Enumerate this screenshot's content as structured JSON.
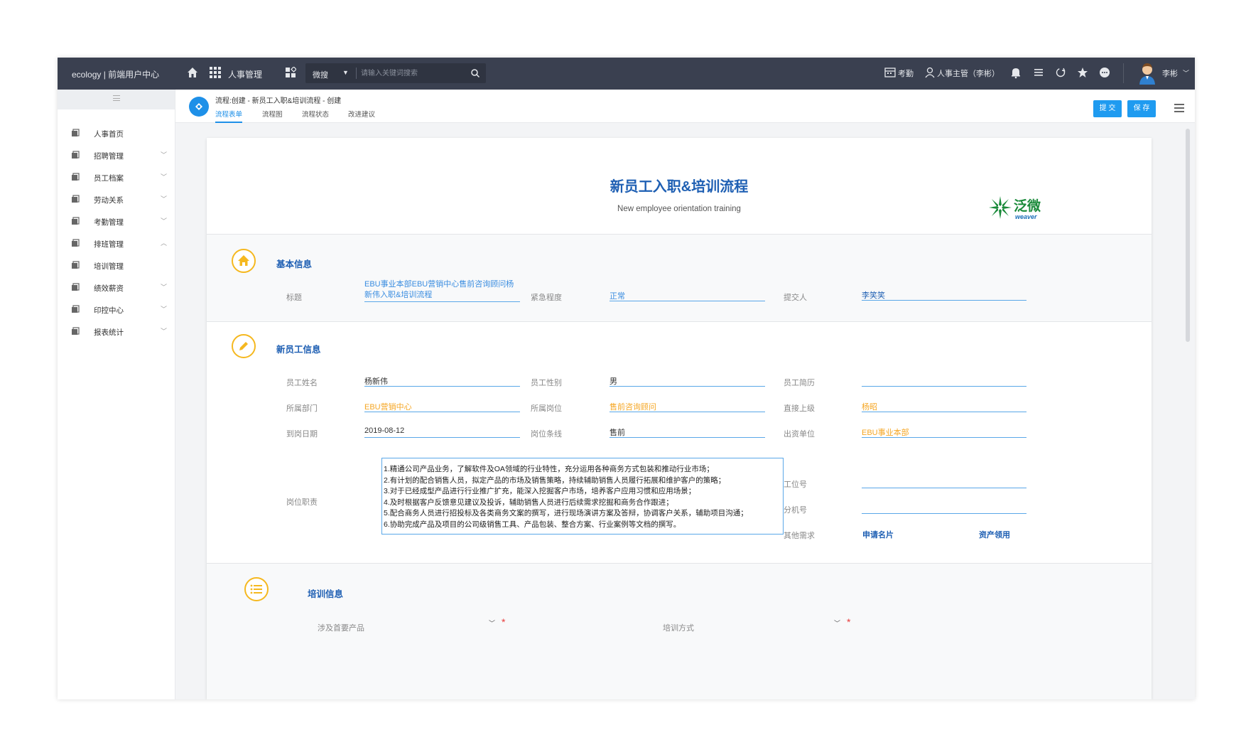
{
  "topbar": {
    "brand": "ecology | 前端用户中心",
    "module": "人事管理",
    "search_scope": "微搜",
    "search_placeholder": "请输入关键词搜索",
    "attendance": "考勤",
    "role": "人事主管（李彬）",
    "user": "李彬"
  },
  "sidebar": {
    "items": [
      {
        "label": "人事首页",
        "chevron": ""
      },
      {
        "label": "招聘管理",
        "chevron": "﹀"
      },
      {
        "label": "员工档案",
        "chevron": "﹀"
      },
      {
        "label": "劳动关系",
        "chevron": "﹀"
      },
      {
        "label": "考勤管理",
        "chevron": "﹀"
      },
      {
        "label": "排班管理",
        "chevron": "︿"
      },
      {
        "label": "培训管理",
        "chevron": ""
      },
      {
        "label": "绩效薪资",
        "chevron": "﹀"
      },
      {
        "label": "印控中心",
        "chevron": "﹀"
      },
      {
        "label": "报表统计",
        "chevron": "﹀"
      }
    ]
  },
  "workflow": {
    "breadcrumb": "流程:创建 - 新员工入职&培训流程 - 创建",
    "tabs": [
      {
        "label": "流程表单",
        "active": true
      },
      {
        "label": "流程图",
        "active": false
      },
      {
        "label": "流程状态",
        "active": false
      },
      {
        "label": "改进建议",
        "active": false
      }
    ],
    "submit_label": "提 交",
    "save_label": "保 存"
  },
  "form": {
    "title": "新员工入职&培训流程",
    "subtitle": "New employee orientation training",
    "logo_cn": "泛微",
    "logo_en": "weaver",
    "basic": {
      "section_title": "基本信息",
      "title_label": "标题",
      "title_value": "EBU事业本部EBU营销中心售前咨询顾问杨新伟入职&培训流程",
      "urgency_label": "紧急程度",
      "urgency_value": "正常",
      "submitter_label": "提交人",
      "submitter_value": "李笑笑"
    },
    "employee": {
      "section_title": "新员工信息",
      "name_label": "员工姓名",
      "name_value": "杨新伟",
      "gender_label": "员工性别",
      "gender_value": "男",
      "resume_label": "员工简历",
      "resume_value": "",
      "dept_label": "所属部门",
      "dept_value": "EBU营销中心",
      "position_label": "所属岗位",
      "position_value": "售前咨询顾问",
      "manager_label": "直接上级",
      "manager_value": "杨昭",
      "date_label": "到岗日期",
      "date_value": "2019-08-12",
      "line_label": "岗位条线",
      "line_value": "售前",
      "unit_label": "出资单位",
      "unit_value": "EBU事业本部",
      "duty_label": "岗位职责",
      "duties": [
        "1.精通公司产品业务，了解软件及OA领域的行业特性，充分运用各种商务方式包装和推动行业市场；",
        "2.有计划的配合销售人员，拟定产品的市场及销售策略，持续辅助销售人员履行拓展和维护客户的策略；",
        "3.对于已经成型产品进行行业推广扩充，能深入挖掘客户市场，培养客户应用习惯和应用场景；",
        "4.及时根据客户反馈意见建议及投诉，辅助销售人员进行后续需求挖掘和商务合作跟进；",
        "5.配合商务人员进行招投标及各类商务文案的撰写，进行现场演讲方案及答辩，协调客户关系，辅助项目沟通；",
        "6.协助完成产品及项目的公司级销售工具、产品包装、整合方案、行业案例等文档的撰写。"
      ],
      "workno_label": "工位号",
      "workno_value": "",
      "ext_label": "分机号",
      "ext_value": "",
      "other_label": "其他需求",
      "other_link1": "申请名片",
      "other_link2": "资产领用"
    },
    "training": {
      "section_title": "培训信息",
      "product_label": "涉及首要产品",
      "mode_label": "培训方式"
    }
  },
  "colors": {
    "topbar": "#3a4050",
    "accent": "#1e90e8",
    "title_blue": "#1e5fb3",
    "orange": "#f5a623",
    "icon_yellow": "#f5b81f"
  }
}
